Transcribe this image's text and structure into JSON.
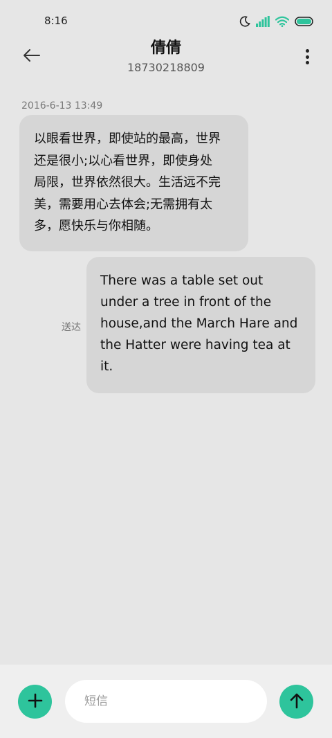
{
  "status_bar": {
    "time": "8:16",
    "icons": [
      "moon-icon",
      "cellular-signal-icon",
      "wifi-icon",
      "battery-icon"
    ],
    "accent_color": "#2ec49c"
  },
  "header": {
    "contact_name": "倩倩",
    "contact_number": "18730218809",
    "back_icon": "arrow-left-icon",
    "more_icon": "more-vertical-icon"
  },
  "messages": [
    {
      "direction": "incoming",
      "timestamp": "2016-6-13 13:49",
      "lines": [
        "以眼看世界，即使站的最高，世界",
        "还是很小;以心看世界，即使身处",
        "局限，世界依然很大。生活远不完",
        "美，需要用心去体会;无需拥有太",
        "多，愿快乐与你相随。"
      ]
    },
    {
      "direction": "outgoing",
      "status": "送达",
      "lines": [
        "There was a table set out",
        "under a tree in front of the",
        "house,and the March Hare and",
        "the Hatter were having tea at",
        "it."
      ]
    }
  ],
  "composer": {
    "placeholder": "短信",
    "value": "",
    "add_icon": "plus-icon",
    "send_icon": "arrow-up-icon"
  }
}
